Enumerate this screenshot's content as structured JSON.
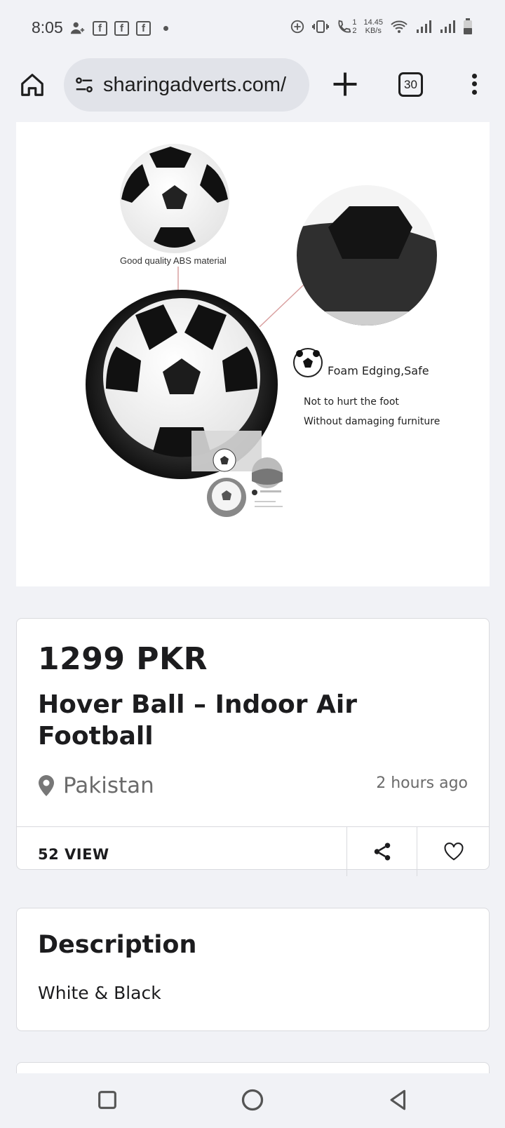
{
  "status_bar": {
    "time": "8:05",
    "net_speed_value": "14.45",
    "net_speed_unit": "KB/s",
    "sim1": "1",
    "sim2": "2",
    "fb_letter": "f"
  },
  "browser": {
    "url": "sharingadverts.com/",
    "tab_count": "30"
  },
  "product_image": {
    "caption_material": "Good quality ABS material",
    "caption_foam": "Foam Edging,Safe",
    "caption_line1": "Not to hurt the foot",
    "caption_line2": "Without damaging furniture"
  },
  "listing": {
    "price": "1299 PKR",
    "title": "Hover Ball – Indoor Air Football",
    "location": "Pakistan",
    "posted": "2 hours ago",
    "views": "52 VIEW"
  },
  "description": {
    "heading": "Description",
    "text": "White & Black"
  },
  "colors": {
    "background": "#f1f2f6",
    "card_border": "#d9dade",
    "url_bar": "#e1e3e9"
  }
}
